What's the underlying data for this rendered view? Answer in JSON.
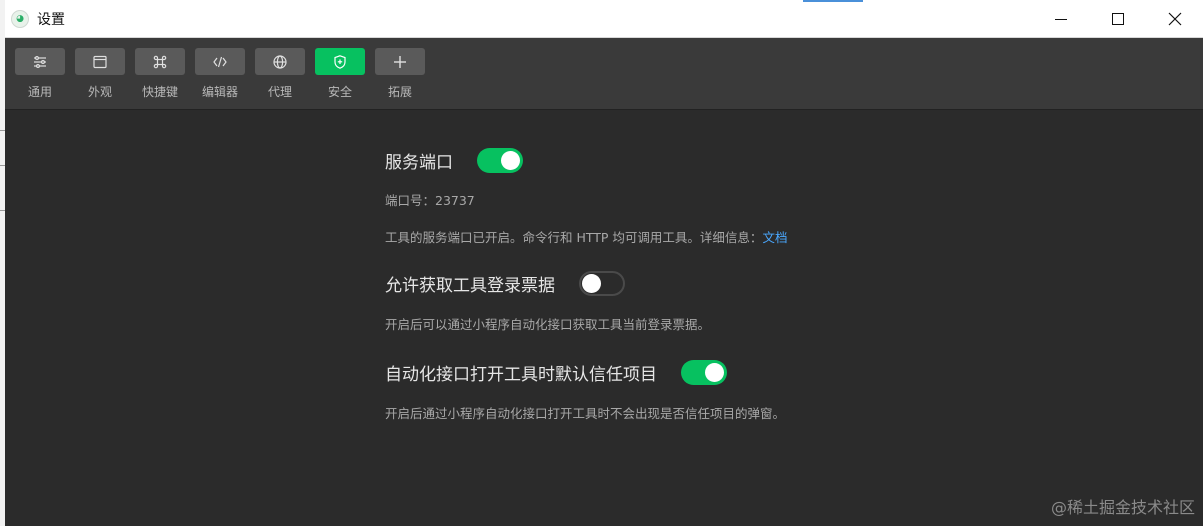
{
  "window": {
    "title": "设置",
    "controls": {
      "minimize": "minimize-icon",
      "maximize": "maximize-icon",
      "close": "close-icon"
    }
  },
  "toolbar": {
    "items": [
      {
        "label": "通用",
        "icon": "sliders-icon",
        "active": false
      },
      {
        "label": "外观",
        "icon": "window-icon",
        "active": false
      },
      {
        "label": "快捷键",
        "icon": "command-icon",
        "active": false
      },
      {
        "label": "编辑器",
        "icon": "code-icon",
        "active": false
      },
      {
        "label": "代理",
        "icon": "globe-icon",
        "active": false
      },
      {
        "label": "安全",
        "icon": "shield-icon",
        "active": true
      },
      {
        "label": "拓展",
        "icon": "plus-icon",
        "active": false
      }
    ]
  },
  "settings": {
    "service_port": {
      "title": "服务端口",
      "enabled": true,
      "port_label": "端口号：23737",
      "description": "工具的服务端口已开启。命令行和 HTTP 均可调用工具。详细信息：",
      "doc_link": "文档"
    },
    "login_ticket": {
      "title": "允许获取工具登录票据",
      "enabled": false,
      "description": "开启后可以通过小程序自动化接口获取工具当前登录票据。"
    },
    "trust_project": {
      "title": "自动化接口打开工具时默认信任项目",
      "enabled": true,
      "description": "开启后通过小程序自动化接口打开工具时不会出现是否信任项目的弹窗。"
    }
  },
  "watermark": "@稀土掘金技术社区",
  "colors": {
    "accent": "#07c160",
    "link": "#4aa8ff"
  }
}
